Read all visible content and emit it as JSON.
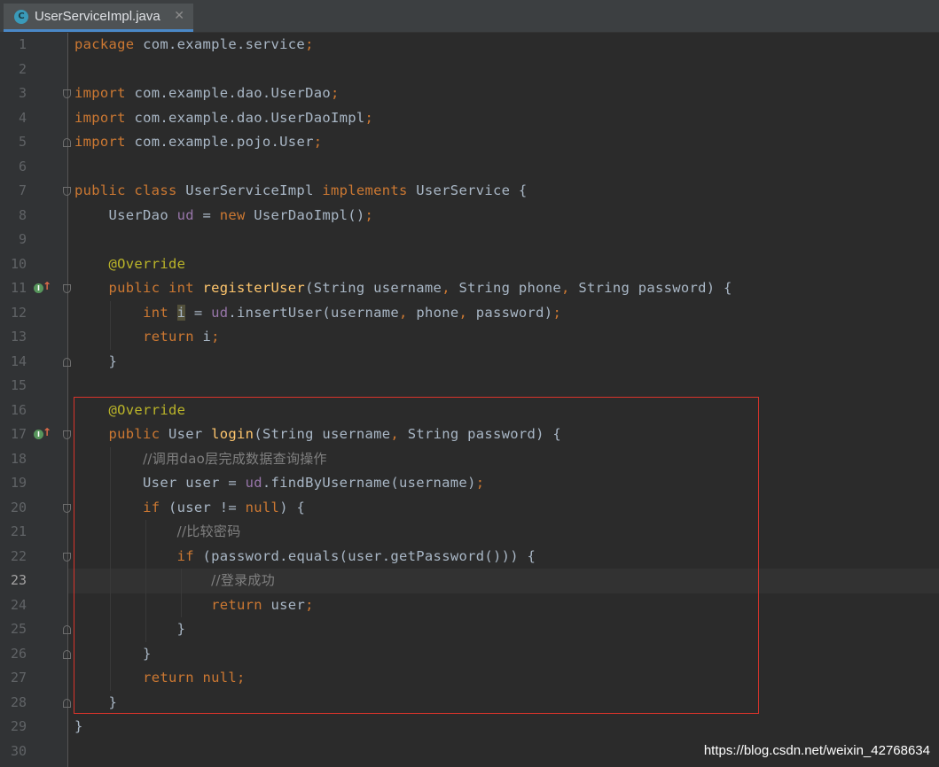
{
  "tab": {
    "title": "UserServiceImpl.java",
    "icon": "C",
    "close": "✕"
  },
  "lines": [
    {
      "n": "1",
      "tokens": [
        [
          "kw",
          "package "
        ],
        [
          "",
          "com.example.service"
        ],
        [
          "kw",
          ";"
        ]
      ]
    },
    {
      "n": "2",
      "tokens": []
    },
    {
      "n": "3",
      "tokens": [
        [
          "kw",
          "import "
        ],
        [
          "",
          "com.example.dao.UserDao"
        ],
        [
          "kw",
          ";"
        ]
      ]
    },
    {
      "n": "4",
      "tokens": [
        [
          "kw",
          "import "
        ],
        [
          "",
          "com.example.dao.UserDaoImpl"
        ],
        [
          "kw",
          ";"
        ]
      ]
    },
    {
      "n": "5",
      "tokens": [
        [
          "kw",
          "import "
        ],
        [
          "",
          "com.example.pojo.User"
        ],
        [
          "kw",
          ";"
        ]
      ]
    },
    {
      "n": "6",
      "tokens": []
    },
    {
      "n": "7",
      "tokens": [
        [
          "kw",
          "public class "
        ],
        [
          "",
          "UserServiceImpl "
        ],
        [
          "kw",
          "implements "
        ],
        [
          "",
          "UserService {"
        ]
      ]
    },
    {
      "n": "8",
      "tokens": [
        [
          "",
          "    UserDao "
        ],
        [
          "fld",
          "ud"
        ],
        [
          "",
          " = "
        ],
        [
          "kw",
          "new "
        ],
        [
          "",
          "UserDaoImpl()"
        ],
        [
          "kw",
          ";"
        ]
      ]
    },
    {
      "n": "9",
      "tokens": []
    },
    {
      "n": "10",
      "tokens": [
        [
          "",
          "    "
        ],
        [
          "ann",
          "@Override"
        ]
      ]
    },
    {
      "n": "11",
      "tokens": [
        [
          "",
          "    "
        ],
        [
          "kw",
          "public int "
        ],
        [
          "fn",
          "registerUser"
        ],
        [
          "",
          "(String username"
        ],
        [
          "kw",
          ", "
        ],
        [
          "",
          "String phone"
        ],
        [
          "kw",
          ", "
        ],
        [
          "",
          "String password) {"
        ]
      ]
    },
    {
      "n": "12",
      "tokens": [
        [
          "",
          "        "
        ],
        [
          "kw",
          "int "
        ],
        [
          "hl",
          "i"
        ],
        [
          "",
          " = "
        ],
        [
          "fld",
          "ud"
        ],
        [
          "",
          ".insertUser(username"
        ],
        [
          "kw",
          ", "
        ],
        [
          "",
          "phone"
        ],
        [
          "kw",
          ", "
        ],
        [
          "",
          "password)"
        ],
        [
          "kw",
          ";"
        ]
      ]
    },
    {
      "n": "13",
      "tokens": [
        [
          "",
          "        "
        ],
        [
          "kw",
          "return "
        ],
        [
          "",
          "i"
        ],
        [
          "kw",
          ";"
        ]
      ]
    },
    {
      "n": "14",
      "tokens": [
        [
          "",
          "    }"
        ]
      ]
    },
    {
      "n": "15",
      "tokens": []
    },
    {
      "n": "16",
      "tokens": [
        [
          "",
          "    "
        ],
        [
          "ann",
          "@Override"
        ]
      ]
    },
    {
      "n": "17",
      "tokens": [
        [
          "",
          "    "
        ],
        [
          "kw",
          "public "
        ],
        [
          "",
          "User "
        ],
        [
          "fn",
          "login"
        ],
        [
          "",
          "(String username"
        ],
        [
          "kw",
          ", "
        ],
        [
          "",
          "String password) {"
        ]
      ]
    },
    {
      "n": "18",
      "tokens": [
        [
          "",
          "        "
        ],
        [
          "cmt",
          "//调用dao层完成数据查询操作"
        ]
      ]
    },
    {
      "n": "19",
      "tokens": [
        [
          "",
          "        User user = "
        ],
        [
          "fld",
          "ud"
        ],
        [
          "",
          ".findByUsername(username)"
        ],
        [
          "kw",
          ";"
        ]
      ]
    },
    {
      "n": "20",
      "tokens": [
        [
          "",
          "        "
        ],
        [
          "kw",
          "if "
        ],
        [
          "",
          "(user != "
        ],
        [
          "kw",
          "null"
        ],
        [
          "",
          ") {"
        ]
      ]
    },
    {
      "n": "21",
      "tokens": [
        [
          "",
          "            "
        ],
        [
          "cmt",
          "//比较密码"
        ]
      ]
    },
    {
      "n": "22",
      "tokens": [
        [
          "",
          "            "
        ],
        [
          "kw",
          "if "
        ],
        [
          "",
          "(password.equals(user.getPassword())) {"
        ]
      ]
    },
    {
      "n": "23",
      "tokens": [
        [
          "",
          "                "
        ],
        [
          "cmt",
          "//登录成功"
        ]
      ]
    },
    {
      "n": "24",
      "tokens": [
        [
          "",
          "                "
        ],
        [
          "kw",
          "return "
        ],
        [
          "",
          "user"
        ],
        [
          "kw",
          ";"
        ]
      ]
    },
    {
      "n": "25",
      "tokens": [
        [
          "",
          "            }"
        ]
      ]
    },
    {
      "n": "26",
      "tokens": [
        [
          "",
          "        }"
        ]
      ]
    },
    {
      "n": "27",
      "tokens": [
        [
          "",
          "        "
        ],
        [
          "kw",
          "return null;"
        ]
      ]
    },
    {
      "n": "28",
      "tokens": [
        [
          "",
          "    }"
        ]
      ]
    },
    {
      "n": "29",
      "tokens": [
        [
          "",
          "}"
        ]
      ]
    },
    {
      "n": "30",
      "tokens": []
    }
  ],
  "current_line": "23",
  "override_markers": [
    "11",
    "17"
  ],
  "watermark": "https://blog.csdn.net/weixin_42768634",
  "colors": {
    "keyword": "#cc7832",
    "field": "#9876aa",
    "method": "#ffc66d",
    "annotation": "#bbb529",
    "comment": "#808080",
    "text": "#a9b7c6",
    "highlight_box": "#d9342b"
  }
}
